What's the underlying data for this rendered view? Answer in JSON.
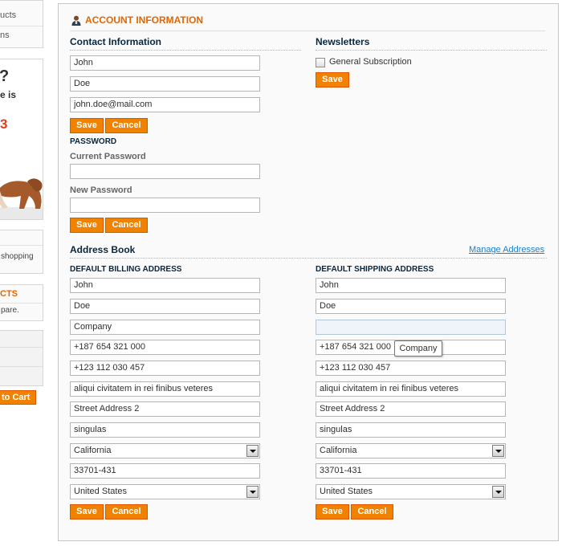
{
  "sidebar": {
    "links": [
      "ucts",
      "ns"
    ],
    "promo": {
      "question": "?",
      "text": "e is",
      "number": "3"
    },
    "cart_text": "shopping",
    "compare_title": "CTS",
    "compare_text": "pare.",
    "add_to_cart": "to Cart"
  },
  "account": {
    "title": "ACCOUNT INFORMATION",
    "contact": {
      "title": "Contact Information",
      "first_name": "John",
      "last_name": "Doe",
      "email": "john.doe@mail.com",
      "save": "Save",
      "cancel": "Cancel"
    },
    "password": {
      "title": "PASSWORD",
      "current_label": "Current Password",
      "current_value": "",
      "new_label": "New Password",
      "new_value": "",
      "save": "Save",
      "cancel": "Cancel"
    },
    "newsletters": {
      "title": "Newsletters",
      "subscription_label": "General Subscription",
      "checked": false,
      "save": "Save"
    }
  },
  "address_book": {
    "title": "Address Book",
    "manage_link": "Manage Addresses",
    "billing": {
      "title": "DEFAULT BILLING ADDRESS",
      "first_name": "John",
      "last_name": "Doe",
      "company": "Company",
      "telephone": "+187 654 321 000",
      "fax": "+123 112 030 457",
      "street1": "aliqui civitatem in rei finibus veteres",
      "street2": "Street Address 2",
      "city": "singulas",
      "region": "California",
      "postcode": "33701-431",
      "country": "United States",
      "save": "Save",
      "cancel": "Cancel"
    },
    "shipping": {
      "title": "DEFAULT SHIPPING ADDRESS",
      "first_name": "John",
      "last_name": "Doe",
      "company": "",
      "company_tooltip": "Company",
      "telephone": "+187 654 321 000",
      "fax": "+123 112 030 457",
      "street1": "aliqui civitatem in rei finibus veteres",
      "street2": "Street Address 2",
      "city": "singulas",
      "region": "California",
      "postcode": "33701-431",
      "country": "United States",
      "save": "Save",
      "cancel": "Cancel"
    }
  },
  "colors": {
    "accent_orange": "#f18200",
    "heading_orange": "#e26703",
    "heading_navy": "#0a263c",
    "link_blue": "#1e7ec8"
  }
}
